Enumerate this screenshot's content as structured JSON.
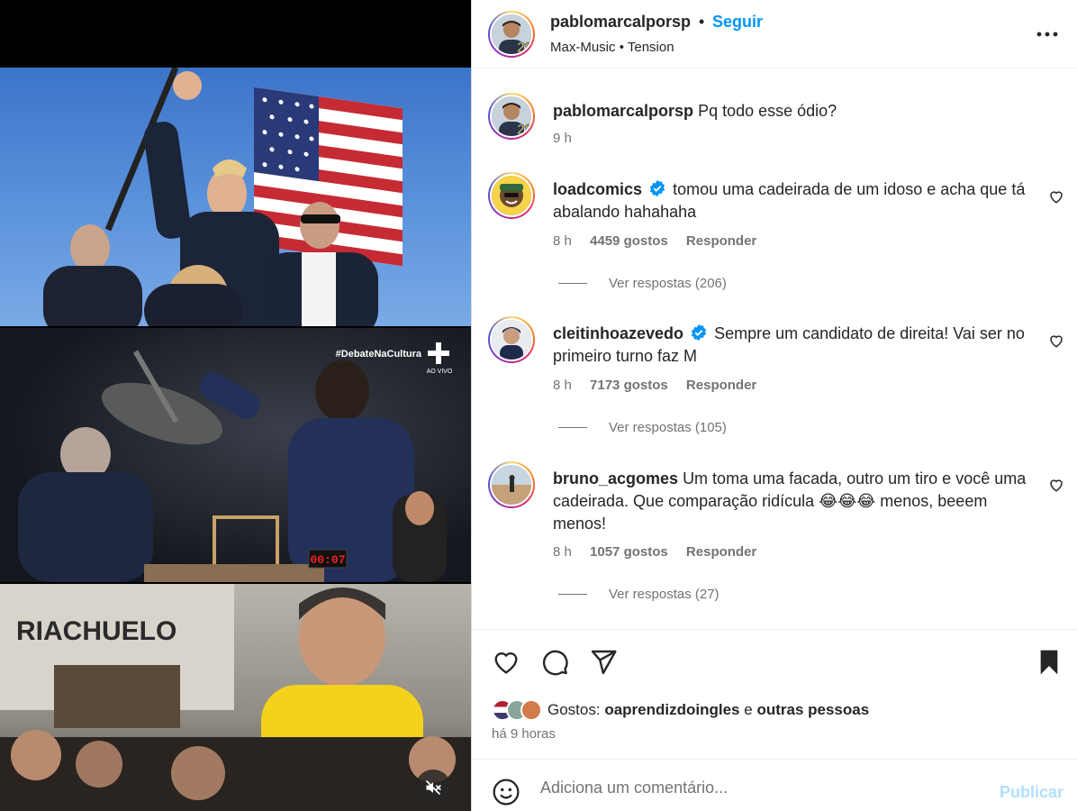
{
  "media": {
    "panel2_overlay_tag": "#DebateNaCultura",
    "panel2_overlay_live": "AO VIVO",
    "panel2_timer": "00:07",
    "panel3_store_sign": "RIACHUELO",
    "mute_icon": "speaker-muted-icon"
  },
  "header": {
    "username": "pablomarcalporsp",
    "separator": "•",
    "follow_label": "Seguir",
    "music_artist": "Max-Music",
    "music_dot": "•",
    "music_track": "Tension",
    "avatar_badge": "28",
    "more_icon": "more-options-icon"
  },
  "caption": {
    "username": "pablomarcalporsp",
    "text": "Pq todo esse ódio?",
    "time": "9 h"
  },
  "comments": [
    {
      "username": "loadcomics",
      "verified": true,
      "text": "tomou uma cadeirada de um idoso e acha que tá abalando hahahaha",
      "time": "8 h",
      "likes": "4459 gostos",
      "reply_label": "Responder",
      "view_replies": "Ver respostas (206)"
    },
    {
      "username": "cleitinhoazevedo",
      "verified": true,
      "text": "Sempre um candidato de direita! Vai ser no primeiro turno faz M",
      "time": "8 h",
      "likes": "7173 gostos",
      "reply_label": "Responder",
      "view_replies": "Ver respostas (105)"
    },
    {
      "username": "bruno_acgomes",
      "verified": false,
      "text": "Um toma uma facada, outro um tiro e você uma cadeirada. Que comparação ridícula 😂😂😂 menos, beeem menos!",
      "time": "8 h",
      "likes": "1057 gostos",
      "reply_label": "Responder",
      "view_replies": "Ver respostas (27)"
    }
  ],
  "actions": {
    "like_icon": "heart-icon",
    "comment_icon": "comment-icon",
    "share_icon": "share-icon",
    "save_icon": "bookmark-icon",
    "likes_prefix": "Gostos:",
    "likes_user": "oaprendizdoingles",
    "likes_conj": "e",
    "likes_others": "outras pessoas",
    "time_ago": "há 9 horas"
  },
  "add_comment": {
    "placeholder": "Adiciona um comentário...",
    "publish_label": "Publicar",
    "emoji_icon": "emoji-icon"
  },
  "colors": {
    "accent": "#0095f6",
    "publish_disabled": "#b2dffc",
    "secondary_text": "#737373"
  }
}
